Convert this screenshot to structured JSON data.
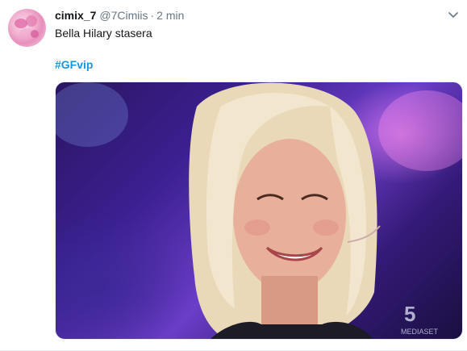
{
  "tweet": {
    "display_name": "cimix_7",
    "handle": "@7Cimiis",
    "separator": "·",
    "time": "2 min",
    "text": "Bella Hilary stasera",
    "hashtag": "#GFvip",
    "menu_icon": "chevron-down-icon",
    "media": {
      "type": "photo",
      "watermark": "5 MEDIASET"
    }
  },
  "colors": {
    "name": "#14171a",
    "meta": "#657786",
    "link": "#1b95e0",
    "border": "#e6ecf0"
  }
}
